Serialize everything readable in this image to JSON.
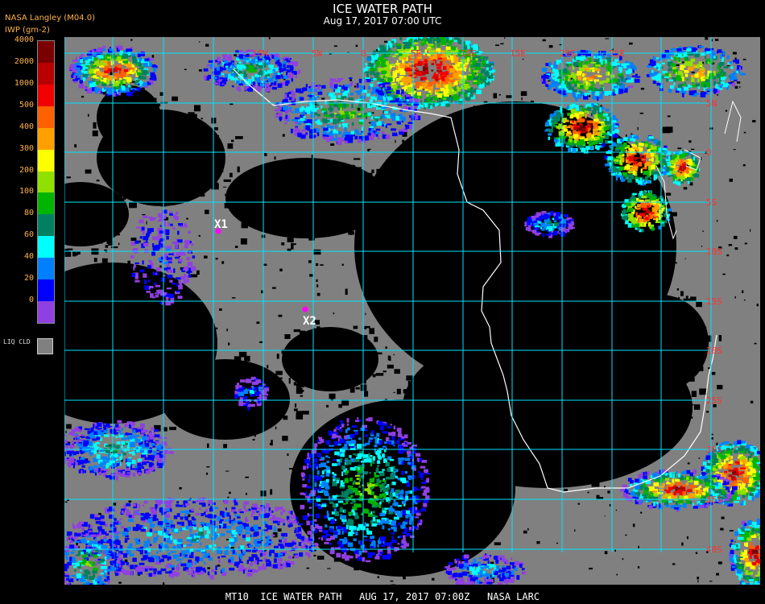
{
  "header": {
    "title": "ICE WATER PATH",
    "subtitle": "Aug 17, 2017 07:00 UTC",
    "product": "NASA Langley (M04.0)",
    "units": "IWP (gm-2)"
  },
  "legend": {
    "levels": [
      {
        "label": "4000",
        "color": "#7a0000"
      },
      {
        "label": "2000",
        "color": "#b80000"
      },
      {
        "label": "1000",
        "color": "#f00000"
      },
      {
        "label": "500",
        "color": "#ff6000"
      },
      {
        "label": "400",
        "color": "#ffa000"
      },
      {
        "label": "300",
        "color": "#ffff00"
      },
      {
        "label": "200",
        "color": "#90e000"
      },
      {
        "label": "100",
        "color": "#00b400"
      },
      {
        "label": "80",
        "color": "#008060"
      },
      {
        "label": "60",
        "color": "#00ffff"
      },
      {
        "label": "40",
        "color": "#0080ff"
      },
      {
        "label": "20",
        "color": "#0000ff"
      },
      {
        "label": "0",
        "color": "#9040e0"
      }
    ],
    "liquid_cloud_label": "LIQ CLD",
    "liquid_cloud_color": "#808080"
  },
  "map": {
    "background_color": "#808080",
    "gridline_color": "#00e5ff",
    "longitude_labels": [
      "10W",
      "5W",
      "0",
      "5E",
      "10E",
      "15E",
      "20E",
      "25E"
    ],
    "latitude_labels": [
      "5N",
      "0",
      "5S",
      "10S",
      "15S",
      "20S",
      "25S",
      "30S",
      "35S",
      "40S"
    ],
    "markers": [
      {
        "label": "X1",
        "color": "#ff00ff"
      },
      {
        "label": "X2",
        "color": "#ff00ff"
      }
    ]
  },
  "footer": {
    "text": "MT10  ICE WATER PATH   AUG 17, 2017 07:00Z   NASA LARC"
  }
}
